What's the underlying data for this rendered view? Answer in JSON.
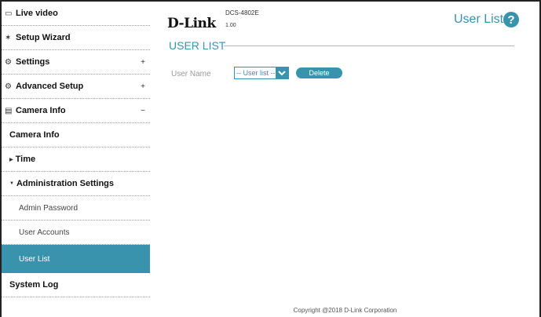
{
  "sidebar": {
    "items": [
      {
        "label": "Live video",
        "icon": "video-icon"
      },
      {
        "label": "Setup Wizard",
        "icon": "wizard-icon"
      },
      {
        "label": "Settings",
        "icon": "gear-icon",
        "toggle": "+"
      },
      {
        "label": "Advanced Setup",
        "icon": "advanced-gear-icon",
        "toggle": "+"
      },
      {
        "label": "Camera Info",
        "icon": "document-icon",
        "toggle": "−"
      },
      {
        "label": "Camera Info"
      },
      {
        "label": "Time"
      },
      {
        "label": "Administration Settings"
      },
      {
        "label": "Admin Password"
      },
      {
        "label": "User Accounts"
      },
      {
        "label": "User List"
      },
      {
        "label": "System Log"
      }
    ]
  },
  "header": {
    "logo": "D-Link",
    "model": "DCS-4802E",
    "firmware": "1.00",
    "page_title": "User List",
    "help_glyph": "?"
  },
  "main": {
    "section_title": "USER LIST",
    "field_label": "User Name",
    "select_value": "-- User list --",
    "delete_label": "Delete"
  },
  "footer": {
    "copyright": "Copyright @2018 D-Link Corporation"
  },
  "colors": {
    "accent": "#3a93ad"
  }
}
